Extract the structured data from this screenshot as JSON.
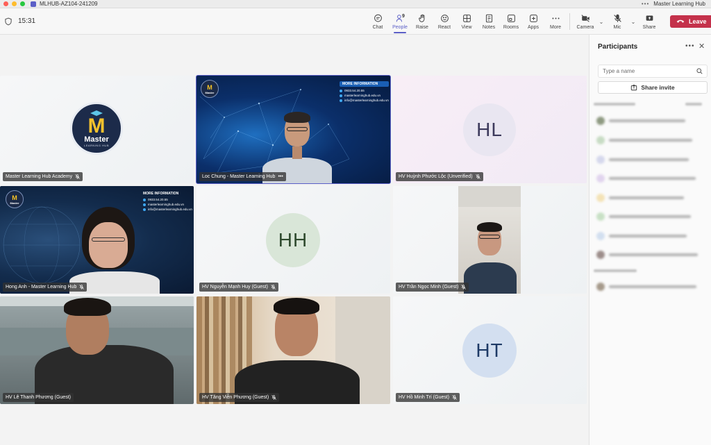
{
  "window": {
    "title": "MLHUB-AZ104-241209",
    "org": "Master Learning Hub"
  },
  "meeting": {
    "timer": "15:31"
  },
  "toolbar": {
    "items": [
      {
        "label": "Chat",
        "icon": "chat-icon"
      },
      {
        "label": "People",
        "icon": "people-icon",
        "count": "9"
      },
      {
        "label": "Raise",
        "icon": "raise-hand-icon"
      },
      {
        "label": "React",
        "icon": "react-icon"
      },
      {
        "label": "View",
        "icon": "view-icon"
      },
      {
        "label": "Notes",
        "icon": "notes-icon"
      },
      {
        "label": "Rooms",
        "icon": "rooms-icon"
      },
      {
        "label": "Apps",
        "icon": "apps-icon"
      },
      {
        "label": "More",
        "icon": "more-icon"
      }
    ],
    "camera_label": "Camera",
    "mic_label": "Mic",
    "share_label": "Share",
    "leave_label": "Leave"
  },
  "tiles": [
    {
      "name": "Master Learning Hub Academy",
      "logo_text": "Master",
      "logo_sub": "LEARNING HUB"
    },
    {
      "name": "Loc Chung - Master Learning Hub",
      "more": "•••",
      "bg_info": {
        "title": "MORE INFORMATION",
        "phone": "0933.54.20.55",
        "web": "masterlearninghub.edu.vn",
        "email": "info@masterlearninghub.edu.vn"
      }
    },
    {
      "name": "HV Huỳnh Phước Lộc (Unverified)",
      "initials": "HL"
    },
    {
      "name": "Hong Anh - Master Learning Hub",
      "bg_info": {
        "title": "MORE INFORMATION",
        "phone": "0933.54.20.55",
        "web": "masterlearninghub.edu.vn",
        "email": "info@masterlearninghub.edu.vn"
      }
    },
    {
      "name": "HV Nguyễn Mạnh Huy (Guest)",
      "initials": "HH"
    },
    {
      "name": "HV Trần Ngọc Minh (Guest)"
    },
    {
      "name": "HV Lê Thanh Phương (Guest)"
    },
    {
      "name": "HV Tăng Viễn Phương (Guest)"
    },
    {
      "name": "HV Hồ Minh Trí (Guest)",
      "initials": "HT"
    }
  ],
  "panel": {
    "title": "Participants",
    "search_placeholder": "Type a name",
    "share_invite_label": "Share invite"
  },
  "colors": {
    "accent": "#5b5fc7",
    "leave": "#c4314b"
  }
}
